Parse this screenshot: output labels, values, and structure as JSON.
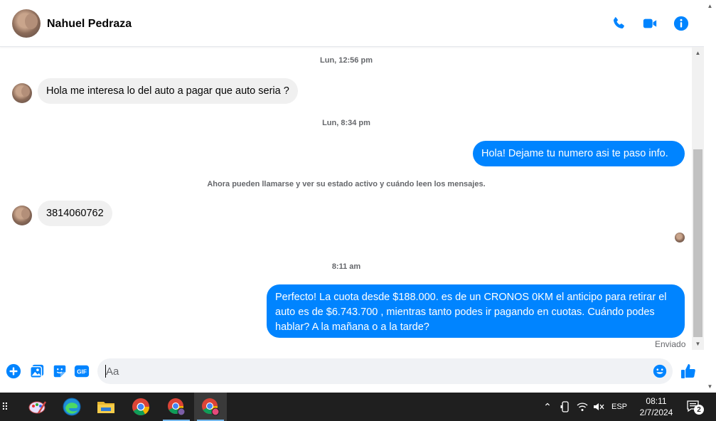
{
  "header": {
    "contact_name": "Nahuel Pedraza"
  },
  "messages": {
    "ts1": "Lun, 12:56 pm",
    "msg1": "Hola me interesa lo del auto a pagar que auto seria  ?",
    "ts2": "Lun, 8:34 pm",
    "msg2": "Hola! Dejame tu numero  asi te paso info.",
    "notice": "Ahora pueden llamarse y ver su estado activo y cuándo leen los mensajes.",
    "msg3": "3814060762",
    "ts3": "8:11 am",
    "msg4": "Perfecto! La cuota desde $188.000. es de un CRONOS 0KM el anticipo para retirar el auto es de $6.743.700 , mientras tanto podes ir pagando en cuotas. Cuándo podes hablar? A la mañana o a la tarde?",
    "status": "Enviado"
  },
  "composer": {
    "placeholder": "Aa",
    "gif_label": "GIF"
  },
  "taskbar": {
    "lang": "ESP",
    "time": "08:11",
    "date": "2/7/2024",
    "notification_count": "2"
  },
  "colors": {
    "accent": "#0084ff",
    "incoming_bubble": "#f0f0f0",
    "taskbar": "#1f1f1f"
  }
}
